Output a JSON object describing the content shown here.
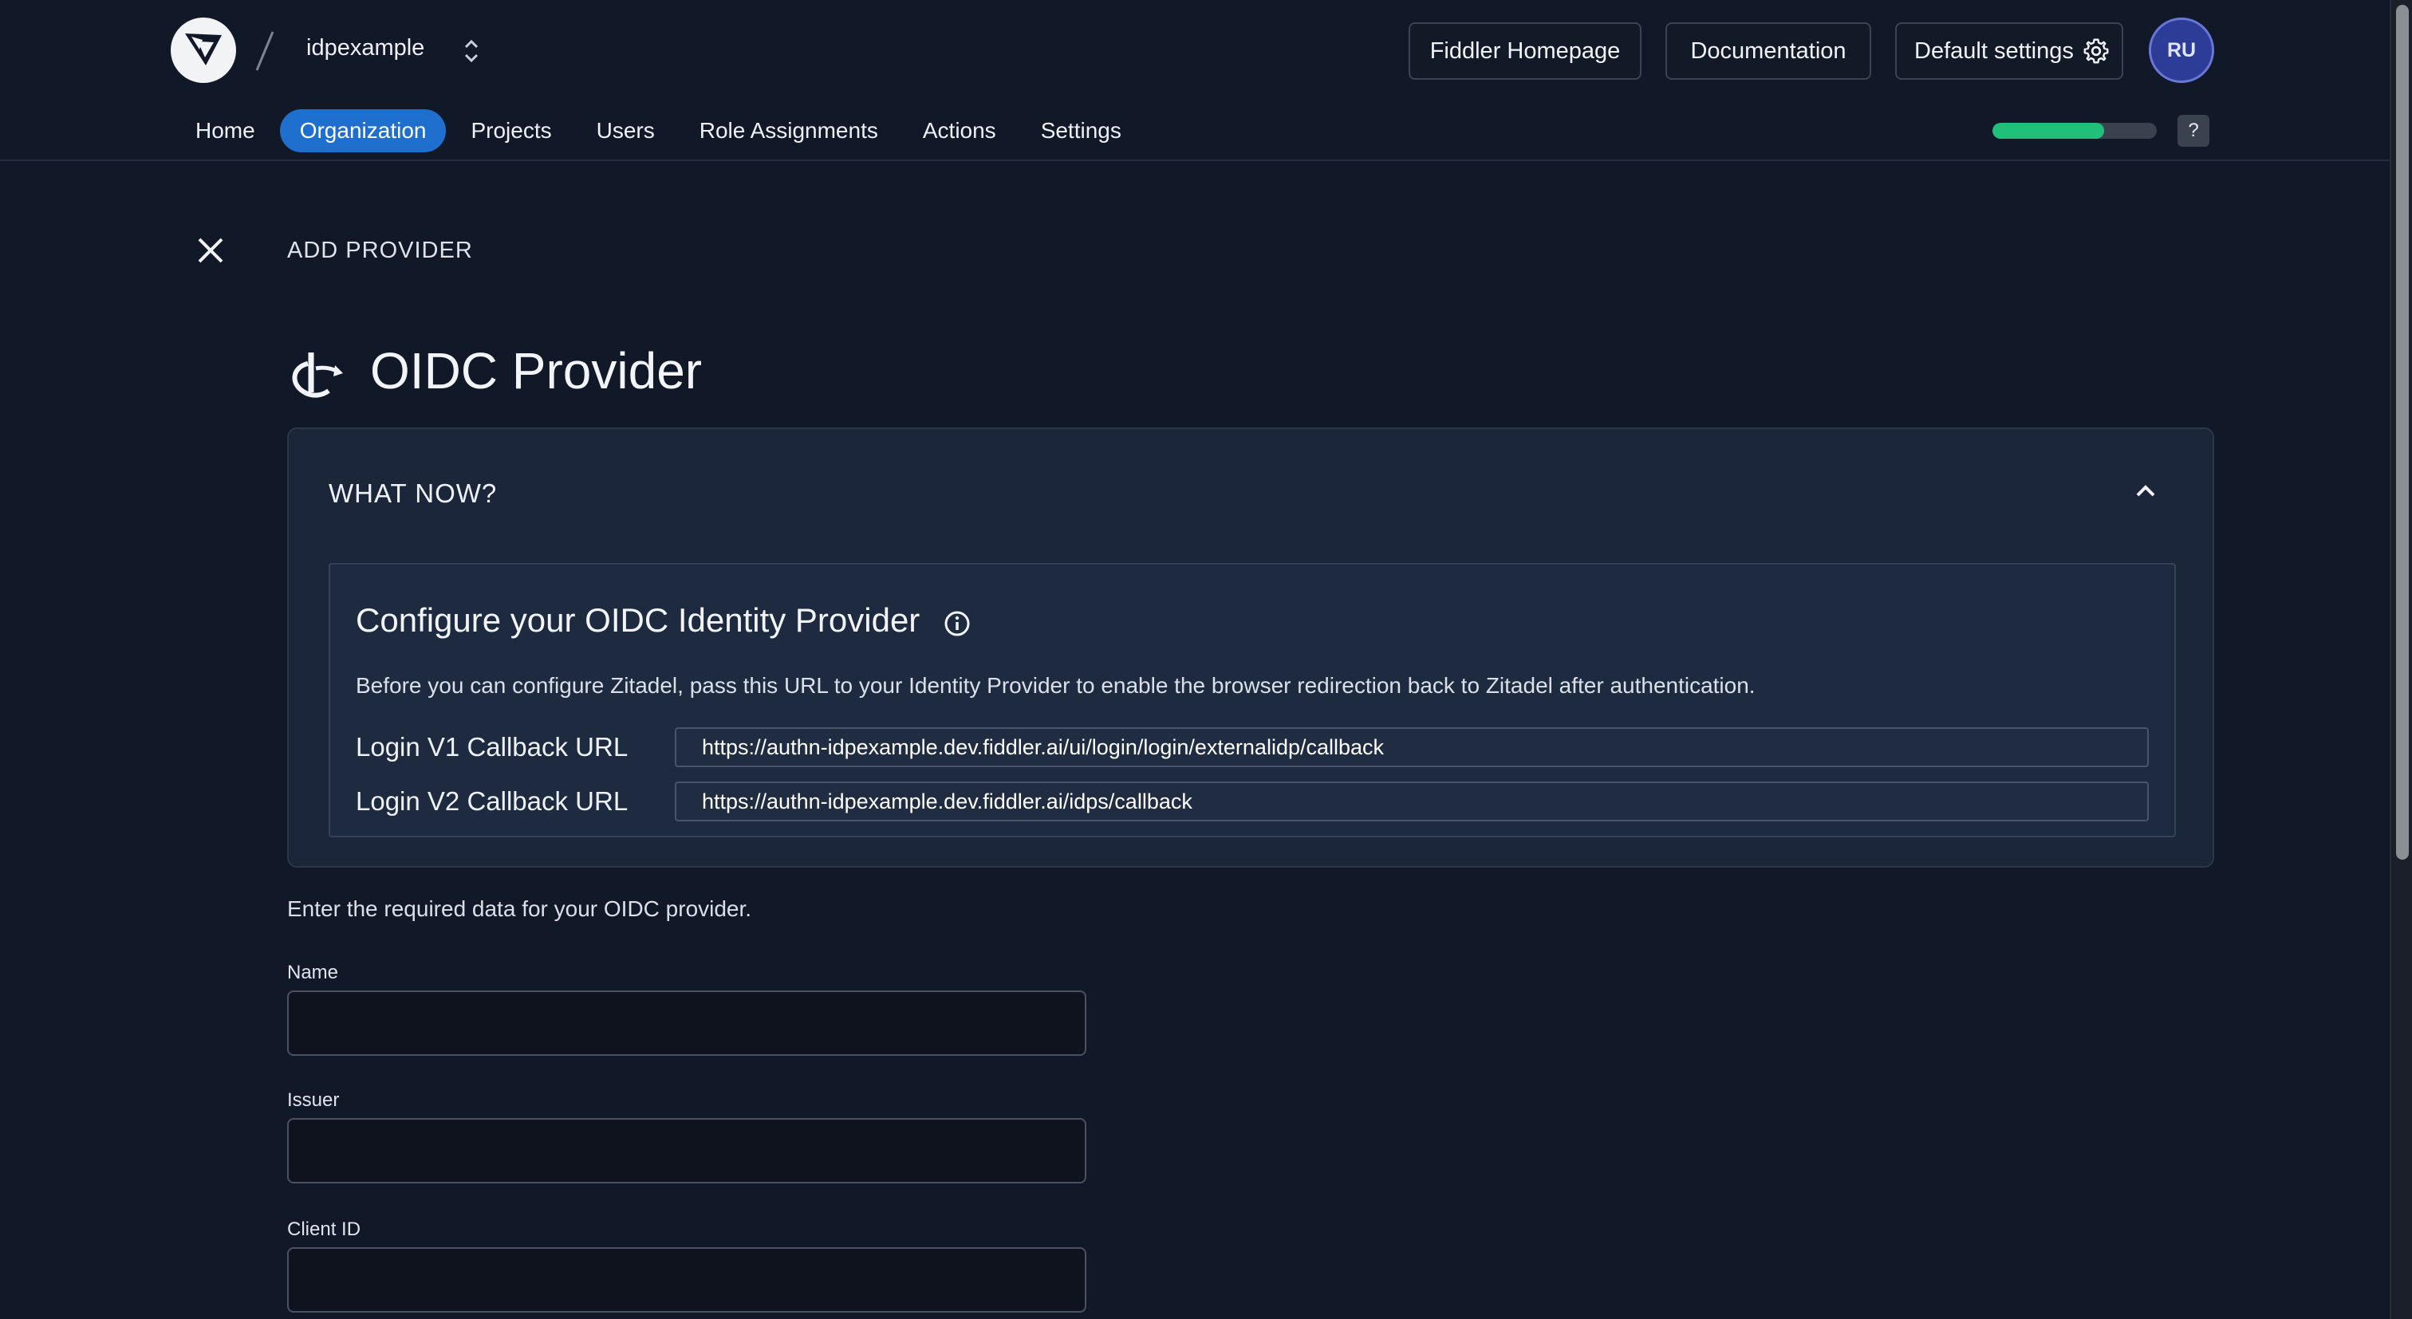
{
  "header": {
    "org_name": "idpexample",
    "buttons": {
      "fiddler_homepage": "Fiddler Homepage",
      "documentation": "Documentation",
      "default_settings": "Default settings"
    },
    "avatar_initials": "RU",
    "help_label": "?",
    "progress_fraction": 0.68
  },
  "nav": {
    "items": [
      {
        "label": "Home"
      },
      {
        "label": "Organization",
        "active": true
      },
      {
        "label": "Projects"
      },
      {
        "label": "Users"
      },
      {
        "label": "Role Assignments"
      },
      {
        "label": "Actions"
      },
      {
        "label": "Settings"
      }
    ]
  },
  "page": {
    "breadcrumb": "ADD PROVIDER",
    "title": "OIDC Provider"
  },
  "what_now": {
    "title": "WHAT NOW?",
    "card": {
      "title": "Configure your OIDC Identity Provider",
      "description": "Before you can configure Zitadel, pass this URL to your Identity Provider to enable the browser redirection back to Zitadel after authentication.",
      "callbacks": [
        {
          "label": "Login V1 Callback URL",
          "value": "https://authn-idpexample.dev.fiddler.ai/ui/login/login/externalidp/callback"
        },
        {
          "label": "Login V2 Callback URL",
          "value": "https://authn-idpexample.dev.fiddler.ai/idps/callback"
        }
      ]
    }
  },
  "form": {
    "intro": "Enter the required data for your OIDC provider.",
    "fields": [
      {
        "label": "Name",
        "value": ""
      },
      {
        "label": "Issuer",
        "value": ""
      },
      {
        "label": "Client ID",
        "value": ""
      }
    ]
  },
  "colors": {
    "background": "#111827",
    "accent": "#1f6fcf",
    "progress": "#21c07a",
    "avatar": "#2d3c96"
  }
}
